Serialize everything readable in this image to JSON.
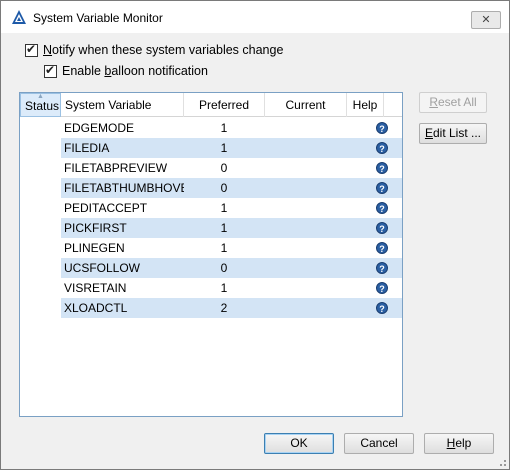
{
  "window": {
    "title": "System Variable Monitor",
    "close_label": "✕"
  },
  "options": {
    "notify": {
      "label_accel": "N",
      "label_rest": "otify when these system variables change",
      "checked": true
    },
    "balloon": {
      "label_pre": "Enable ",
      "label_accel": "b",
      "label_rest": "alloon notification",
      "checked": true
    }
  },
  "table": {
    "columns": [
      "Status",
      "System Variable",
      "Preferred",
      "Current",
      "Help"
    ],
    "sort_arrow": "▲",
    "rows": [
      {
        "name": "EDGEMODE",
        "preferred": "1",
        "current": ""
      },
      {
        "name": "FILEDIA",
        "preferred": "1",
        "current": ""
      },
      {
        "name": "FILETABPREVIEW",
        "preferred": "0",
        "current": ""
      },
      {
        "name": "FILETABTHUMBHOVER",
        "preferred": "0",
        "current": ""
      },
      {
        "name": "PEDITACCEPT",
        "preferred": "1",
        "current": ""
      },
      {
        "name": "PICKFIRST",
        "preferred": "1",
        "current": ""
      },
      {
        "name": "PLINEGEN",
        "preferred": "1",
        "current": ""
      },
      {
        "name": "UCSFOLLOW",
        "preferred": "0",
        "current": ""
      },
      {
        "name": "VISRETAIN",
        "preferred": "1",
        "current": ""
      },
      {
        "name": "XLOADCTL",
        "preferred": "2",
        "current": ""
      }
    ],
    "help_glyph": "?"
  },
  "side_buttons": {
    "reset_accel": "R",
    "reset_rest": "eset All",
    "edit_accel": "E",
    "edit_rest": "dit List ..."
  },
  "footer": {
    "ok": "OK",
    "cancel": "Cancel",
    "help_accel": "H",
    "help_rest": "elp"
  },
  "colors": {
    "accent": "#3c7fb1",
    "row_alt": "#d3e4f5",
    "help_icon": "#2a5fa3"
  }
}
